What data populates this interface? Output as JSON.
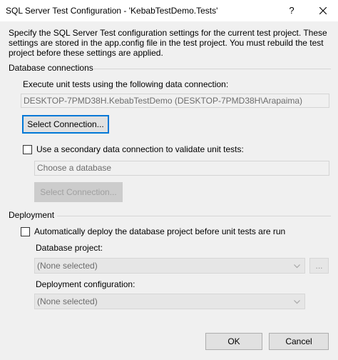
{
  "window": {
    "title": "SQL Server Test Configuration - 'KebabTestDemo.Tests'",
    "help_label": "?"
  },
  "intro_text": "Specify the SQL Server Test configuration settings for the current test project. These settings are stored in the app.config file in the test project. You must rebuild the test project before these settings are applied.",
  "database_connections": {
    "section_label": "Database connections",
    "execute_label": "Execute unit tests using the following data connection:",
    "connection_value": "DESKTOP-7PMD38H.KebabTestDemo (DESKTOP-7PMD38H\\Arapaima)",
    "select_connection_label": "Select Connection...",
    "secondary_checkbox_label": "Use a secondary data connection to validate unit tests:",
    "secondary_checked": false,
    "choose_db_placeholder": "Choose a database",
    "secondary_select_connection_label": "Select Connection..."
  },
  "deployment": {
    "section_label": "Deployment",
    "auto_deploy_label": "Automatically deploy the database project before unit tests are run",
    "auto_deploy_checked": false,
    "database_project_label": "Database project:",
    "database_project_value": "(None selected)",
    "browse_label": "...",
    "deployment_config_label": "Deployment configuration:",
    "deployment_config_value": "(None selected)"
  },
  "footer": {
    "ok_label": "OK",
    "cancel_label": "Cancel"
  },
  "colors": {
    "focus_accent": "#0078d7",
    "window_background": "#f0f0f0",
    "disabled_text": "#a0a0a0"
  },
  "icons": {
    "close": "close-icon",
    "dropdown": "chevron-down-icon"
  }
}
